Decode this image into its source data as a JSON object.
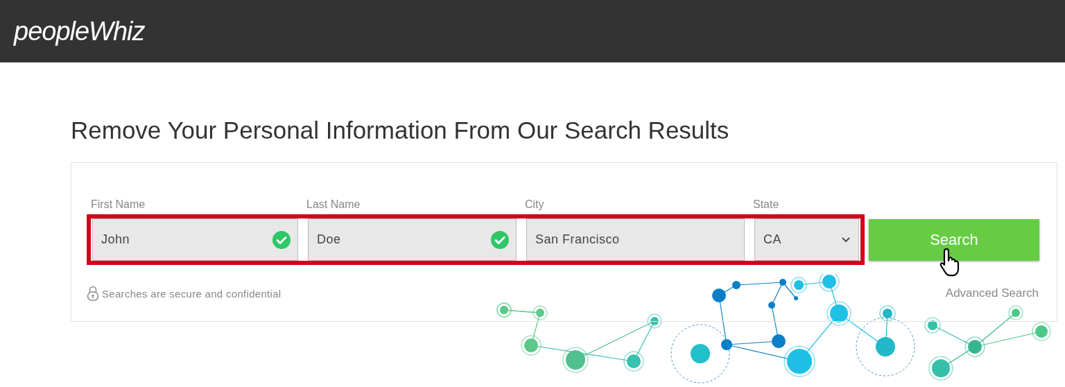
{
  "header": {
    "logo": "peopleWhiz"
  },
  "title": "Remove Your Personal Information From Our Search Results",
  "form": {
    "highlighted": true,
    "fields": [
      {
        "kind": "text",
        "label": "First Name",
        "value": "John",
        "valid": true
      },
      {
        "kind": "text",
        "label": "Last Name",
        "value": "Doe",
        "valid": true
      },
      {
        "kind": "text",
        "label": "City",
        "value": "San Francisco",
        "valid": false
      },
      {
        "kind": "select",
        "label": "State",
        "value": "CA"
      }
    ],
    "search_button": "Search",
    "secure_note": "Searches are secure and confidential",
    "advanced_link": "Advanced Search"
  }
}
